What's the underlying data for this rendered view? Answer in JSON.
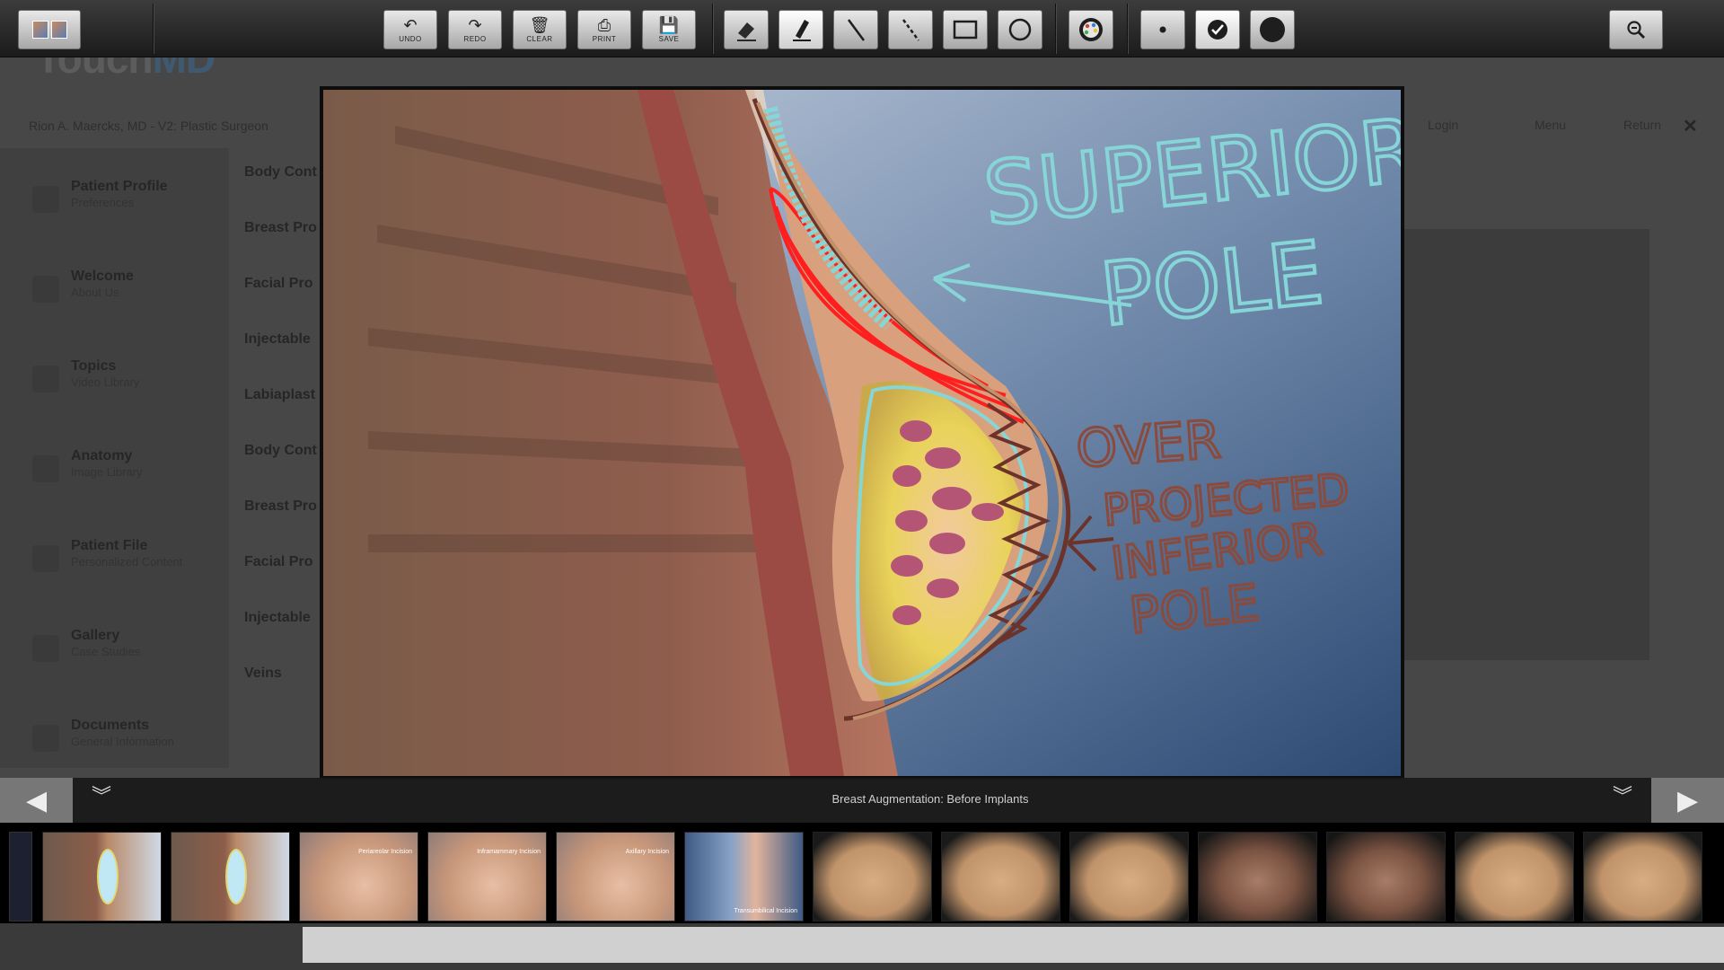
{
  "toolbar": {
    "gallery_label": "",
    "undo_label": "UNDO",
    "redo_label": "REDO",
    "clear_label": "CLEAR",
    "print_label": "PRINT",
    "save_label": "SAVE",
    "icons": [
      "undo-icon",
      "redo-icon",
      "trash-icon",
      "printer-icon",
      "floppy-icon",
      "eraser-icon",
      "marker-icon",
      "line-icon",
      "dashed-line-icon",
      "rectangle-icon",
      "circle-icon",
      "palette-icon",
      "small-dot-icon",
      "checkmark-icon",
      "large-dot-icon",
      "zoom-out-icon"
    ]
  },
  "background_app": {
    "logo_text": "Touch",
    "logo_accent": "MD",
    "doctor": "Rion A. Maercks, MD - V2: Plastic Surgeon",
    "nav_login": "Login",
    "nav_menu": "Menu",
    "nav_return": "Return",
    "close": "✕",
    "sidebar": [
      {
        "title": "Patient Profile",
        "subtitle": "Preferences"
      },
      {
        "title": "Welcome",
        "subtitle": "About Us"
      },
      {
        "title": "Topics",
        "subtitle": "Video Library"
      },
      {
        "title": "Anatomy",
        "subtitle": "Image Library"
      },
      {
        "title": "Patient File",
        "subtitle": "Personalized Content"
      },
      {
        "title": "Gallery",
        "subtitle": "Case Studies"
      },
      {
        "title": "Documents",
        "subtitle": "General Information"
      }
    ],
    "categories": [
      "Body Cont",
      "Breast Pro",
      "Facial Pro",
      "Injectable",
      "Labiaplast",
      "Body Cont",
      "Breast Pro",
      "Facial Pro",
      "Injectable",
      "Veins"
    ]
  },
  "viewer": {
    "annotation_superior": [
      "SUPERIOR",
      "POLE"
    ],
    "annotation_inferior": [
      "OVER",
      "PROJECTED",
      "INFERIOR",
      "POLE"
    ],
    "colors": {
      "cyan": "#86d6d8",
      "red": "#ff1f1f",
      "brown": "#6b3329",
      "tan": "#c2906a"
    }
  },
  "navbar": {
    "caption": "Breast Augmentation: Before Implants",
    "prev_glyph": "◀",
    "next_glyph": "▶",
    "collapse_glyph": "⌄"
  },
  "thumbnails": [
    {
      "style": "anat",
      "label": ""
    },
    {
      "style": "anat",
      "label": ""
    },
    {
      "style": "skin",
      "label": "Periareolar Incision"
    },
    {
      "style": "skin",
      "label": "Inframammary Incision"
    },
    {
      "style": "skin",
      "label": "Axillary Incision"
    },
    {
      "style": "skinblue",
      "label": "Transumbilical Incision"
    },
    {
      "style": "torso",
      "label": ""
    },
    {
      "style": "torso",
      "label": ""
    },
    {
      "style": "torso",
      "label": ""
    },
    {
      "style": "dark",
      "label": ""
    },
    {
      "style": "dark",
      "label": ""
    },
    {
      "style": "torso",
      "label": ""
    },
    {
      "style": "torso",
      "label": ""
    }
  ]
}
